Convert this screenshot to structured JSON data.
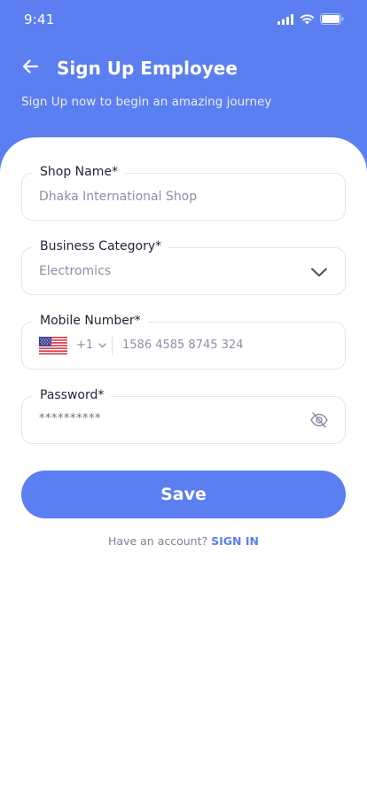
{
  "status_bar": {
    "time": "9:41",
    "icons": [
      "cellular-signal-icon",
      "wifi-icon",
      "battery-icon"
    ]
  },
  "header": {
    "back_icon": "arrow-left-icon",
    "title": "Sign Up Employee",
    "subtitle": "Sign Up now to begin an amazing journey"
  },
  "form": {
    "shop_name": {
      "label": "Shop Name*",
      "value": "Dhaka  International Shop"
    },
    "business_category": {
      "label": "Business Category*",
      "value": "Electromics",
      "icon": "chevron-down-icon"
    },
    "mobile_number": {
      "label": "Mobile Number*",
      "flag_icon": "us-flag-icon",
      "dial_code": "+1",
      "value": "1586 4585 8745 324"
    },
    "password": {
      "label": "Password*",
      "value": "**********",
      "icon": "eye-off-icon"
    }
  },
  "actions": {
    "save_label": "Save",
    "signin_prompt": "Have an account?",
    "signin_label": "SIGN IN"
  },
  "colors": {
    "primary": "#5b7ff0",
    "background": "#ffffff",
    "border": "#e3e5ee",
    "label": "#1f2437",
    "muted": "#8c90a3"
  }
}
